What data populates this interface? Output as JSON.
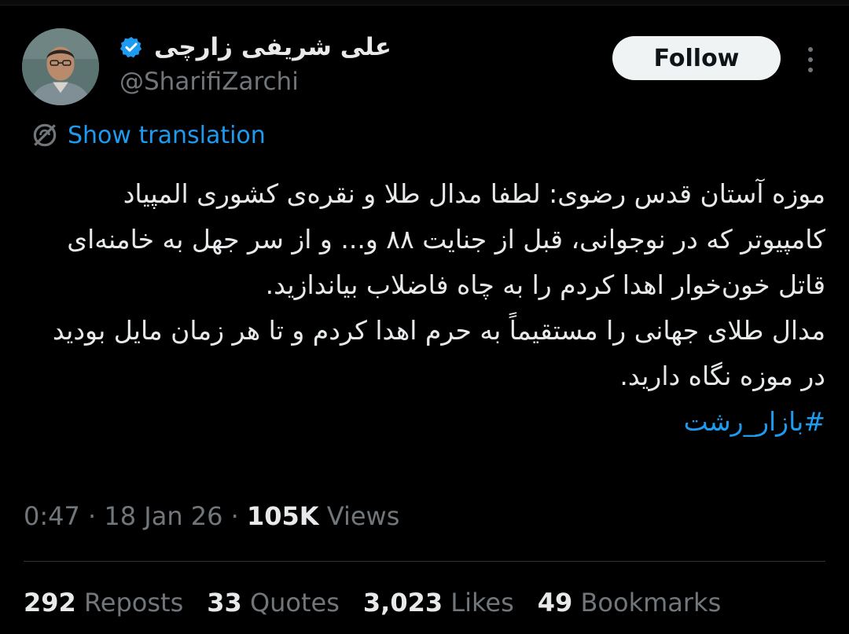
{
  "author": {
    "display_name": "علی شریفی زارچی",
    "handle": "@SharifiZarchi",
    "verified": true
  },
  "follow_label": "Follow",
  "translate_label": "Show translation",
  "tweet": {
    "paragraph1": "موزه آستان قدس رضوی: لطفا مدال طلا و نقره‌ی کشوری المپیاد کامپیوتر که در نوجوانی، قبل از جنایت ۸۸ و... و از سر جهل به خامنه‌ای قاتل خون‌خوار اهدا کردم را به چاه فاضلاب بیاندازید.",
    "paragraph2": "مدال طلای جهانی را مستقیماً به حرم اهدا کردم و تا هر زمان مایل بودید در موزه نگاه دارید.",
    "hashtag": "#بازار_رشت"
  },
  "meta": {
    "time": "0:47",
    "date": "18 Jan 26",
    "views_count": "105K",
    "views_label": "Views",
    "sep": "·"
  },
  "stats": [
    {
      "count": "292",
      "label": "Reposts"
    },
    {
      "count": "33",
      "label": "Quotes"
    },
    {
      "count": "3,023",
      "label": "Likes"
    },
    {
      "count": "49",
      "label": "Bookmarks"
    }
  ],
  "colors": {
    "background": "#000000",
    "text": "#e7e9ea",
    "muted": "#71767b",
    "accent": "#1d9bf0",
    "follow_bg": "#eff3f4"
  },
  "icons": {
    "verified": "verified-badge-icon",
    "more": "more-options-icon",
    "translate": "globe-icon"
  }
}
